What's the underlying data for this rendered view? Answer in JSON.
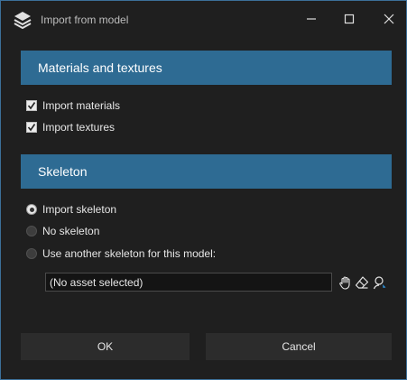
{
  "window": {
    "title": "Import from model"
  },
  "sections": {
    "materials": {
      "header": "Materials and textures",
      "import_materials": {
        "label": "Import materials",
        "checked": true
      },
      "import_textures": {
        "label": "Import textures",
        "checked": true
      }
    },
    "skeleton": {
      "header": "Skeleton",
      "options": [
        {
          "label": "Import skeleton",
          "selected": true
        },
        {
          "label": "No skeleton",
          "selected": false
        },
        {
          "label": "Use another skeleton for this model:",
          "selected": false
        }
      ],
      "asset_field": {
        "value": "(No asset selected)"
      }
    }
  },
  "buttons": {
    "ok": "OK",
    "cancel": "Cancel"
  },
  "colors": {
    "accent": "#2e6b93",
    "background": "#1f1f1f",
    "button": "#2c2c2c"
  },
  "icons": [
    "app-logo-icon",
    "minimize-icon",
    "maximize-icon",
    "close-icon",
    "hand-icon",
    "eraser-icon",
    "select-asset-icon"
  ]
}
